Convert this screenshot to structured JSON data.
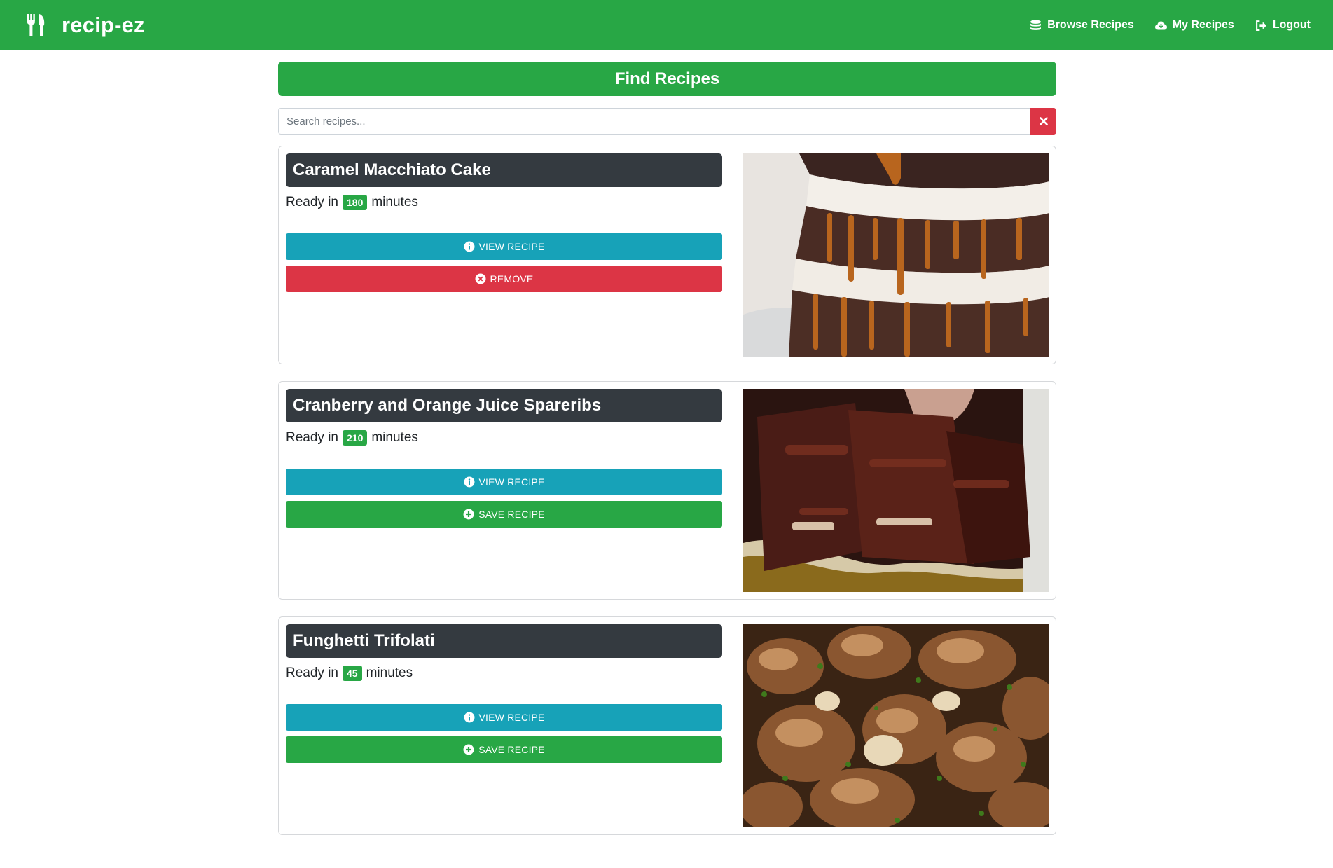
{
  "brand": {
    "name": "recip-ez",
    "icon": "fork-knife-icon"
  },
  "nav": {
    "browse_label": "Browse Recipes",
    "my_recipes_label": "My Recipes",
    "logout_label": "Logout"
  },
  "find": {
    "header": "Find Recipes",
    "search_placeholder": "Search recipes...",
    "search_value": ""
  },
  "recipes": [
    {
      "title": "Caramel Macchiato Cake",
      "ready_prefix": "Ready in",
      "minutes": "180",
      "ready_suffix": "minutes",
      "view_label": "VIEW RECIPE",
      "action_label": "REMOVE",
      "action_kind": "remove"
    },
    {
      "title": "Cranberry and Orange Juice Spareribs",
      "ready_prefix": "Ready in",
      "minutes": "210",
      "ready_suffix": "minutes",
      "view_label": "VIEW RECIPE",
      "action_label": "SAVE RECIPE",
      "action_kind": "save"
    },
    {
      "title": "Funghetti Trifolati",
      "ready_prefix": "Ready in",
      "minutes": "45",
      "ready_suffix": "minutes",
      "view_label": "VIEW RECIPE",
      "action_label": "SAVE RECIPE",
      "action_kind": "save"
    }
  ],
  "colors": {
    "primary_green": "#28a745",
    "info_blue": "#17a2b8",
    "danger_red": "#dc3545",
    "dark_title": "#343a40"
  }
}
